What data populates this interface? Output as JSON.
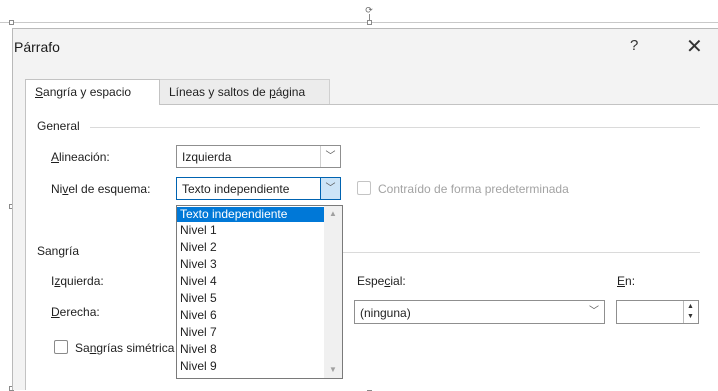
{
  "dialog": {
    "title": "Párrafo",
    "help_label": "?",
    "close_label": "✕"
  },
  "tabs": [
    {
      "label_pre": "",
      "label_u": "S",
      "label_post": "angría y espacio",
      "active": true
    },
    {
      "label_pre": "Líneas y saltos de ",
      "label_u": "p",
      "label_post": "ágina",
      "active": false
    }
  ],
  "general": {
    "heading": "General",
    "alignment": {
      "label_u": "A",
      "label_post": "lineación:",
      "value": "Izquierda"
    },
    "outline_level": {
      "label_pre": "Ni",
      "label_u": "v",
      "label_post": "el de esquema:",
      "value": "Texto independiente"
    },
    "collapsed_label": "Contraído de forma predeterminada"
  },
  "outline_options": [
    "Texto independiente",
    "Nivel 1",
    "Nivel 2",
    "Nivel 3",
    "Nivel 4",
    "Nivel 5",
    "Nivel 6",
    "Nivel 7",
    "Nivel 8",
    "Nivel 9"
  ],
  "indent": {
    "heading": "Sangría",
    "left": {
      "label_pre": "I",
      "label_u": "z",
      "label_post": "quierda:"
    },
    "right": {
      "label_u": "D",
      "label_post": "erecha:"
    },
    "special": {
      "label_pre": "Espe",
      "label_u": "c",
      "label_post": "ial:",
      "value": "(ninguna)"
    },
    "by": {
      "label_u": "E",
      "label_post": "n:",
      "value": ""
    },
    "mirror": {
      "label_pre": "Sa",
      "label_u": "n",
      "label_post": "grías simétrica"
    }
  },
  "icons": {
    "rotate": "rotate-handle-icon",
    "chevron": "chevron-down-icon",
    "close": "close-icon"
  }
}
